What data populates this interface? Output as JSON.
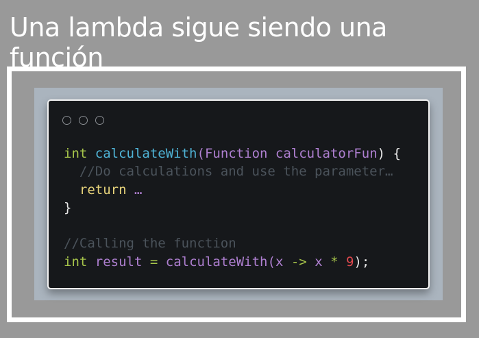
{
  "title": "Una lambda sigue siendo una función",
  "code": {
    "l1": {
      "kw": "int",
      "fn": "calculateWith",
      "p1": "(",
      "type": "Function",
      "param": "calculatorFun",
      "end": ") {"
    },
    "l2": "//Do calculations and use the parameter…",
    "l3": {
      "kw": "return",
      "rest": "…"
    },
    "l4": "}",
    "l6": "//Calling the function",
    "l7": {
      "kw": "int",
      "var": "result",
      "eq": "=",
      "fn": "calculateWith",
      "p1": "(",
      "x1": "x",
      "arrow": "->",
      "x2": "x",
      "star": "*",
      "num": "9",
      "end": ");"
    }
  },
  "colors": {
    "background": "#999999",
    "code_bg": "#16181b",
    "keyword": "#a6c44a",
    "function": "#4fb3d6",
    "identifier": "#ae7fd0",
    "comment": "#4b535b",
    "return": "#e6d27a",
    "number": "#e0484e"
  }
}
